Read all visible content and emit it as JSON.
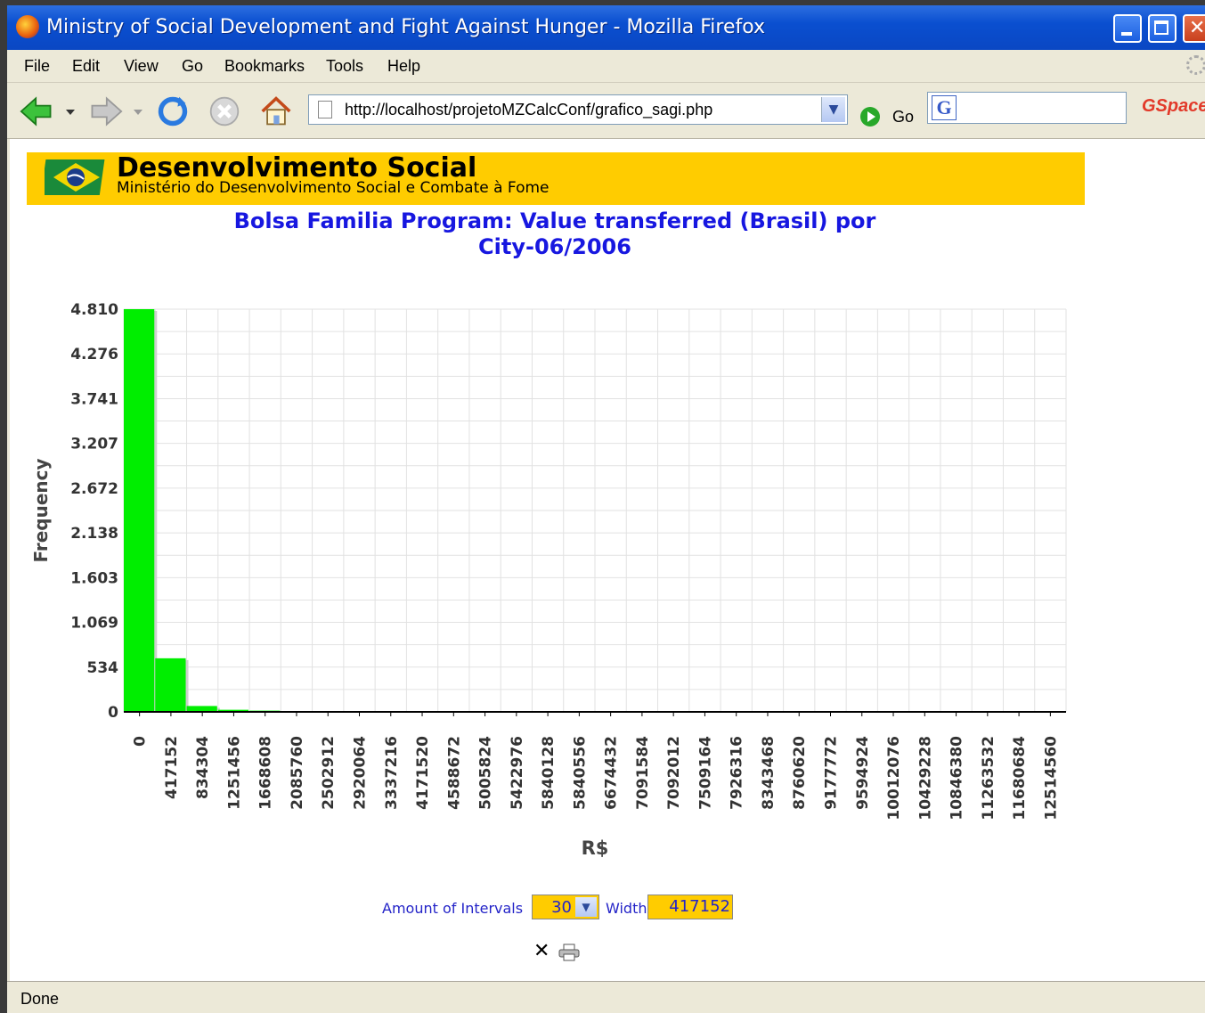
{
  "window": {
    "title": "Ministry of Social Development and Fight Against Hunger - Mozilla Firefox"
  },
  "menu": [
    "File",
    "Edit",
    "View",
    "Go",
    "Bookmarks",
    "Tools",
    "Help"
  ],
  "toolbar": {
    "url": "http://localhost/projetoMZCalcConf/grafico_sagi.php",
    "go_label": "Go",
    "search_value": "",
    "addon_label": "GSpace"
  },
  "banner": {
    "title": "Desenvolvimento Social",
    "subtitle": "Ministério do Desenvolvimento Social e Combate à Fome"
  },
  "chart_data": {
    "type": "bar",
    "title": "Bolsa Familia Program: Value transferred (Brasil) por City-06/2006",
    "xlabel": "R$",
    "ylabel": "Frequency",
    "ylim": [
      0,
      4810
    ],
    "y_ticks": [
      "0",
      "534",
      "1.069",
      "1.603",
      "2.138",
      "2.672",
      "3.207",
      "3.741",
      "4.276",
      "4.810"
    ],
    "y_tick_values": [
      0,
      534,
      1069,
      1603,
      2138,
      2672,
      3207,
      3741,
      4276,
      4810
    ],
    "categories": [
      "0",
      "417152",
      "834304",
      "1251456",
      "1668608",
      "2085760",
      "2502912",
      "2920064",
      "3337216",
      "4171520",
      "4588672",
      "5005824",
      "5422976",
      "5840128",
      "5840556",
      "6674432",
      "7091584",
      "7092012",
      "7509164",
      "7926316",
      "8343468",
      "8760620",
      "9177772",
      "9594924",
      "10012076",
      "10429228",
      "10846380",
      "11263532",
      "11680684",
      "12514560"
    ],
    "values": [
      4810,
      640,
      70,
      25,
      15,
      8,
      0,
      0,
      0,
      0,
      0,
      0,
      0,
      0,
      0,
      0,
      0,
      0,
      0,
      0,
      0,
      0,
      0,
      0,
      0,
      0,
      0,
      0,
      0,
      0
    ],
    "grid": true,
    "bar_color": "#00ee00"
  },
  "controls": {
    "intervals_label": "Amount of Intervals",
    "intervals_value": "30",
    "width_label": "Width",
    "width_value": "417152"
  },
  "footer_icons": {
    "close": "✕"
  },
  "status": {
    "text": "Done"
  }
}
